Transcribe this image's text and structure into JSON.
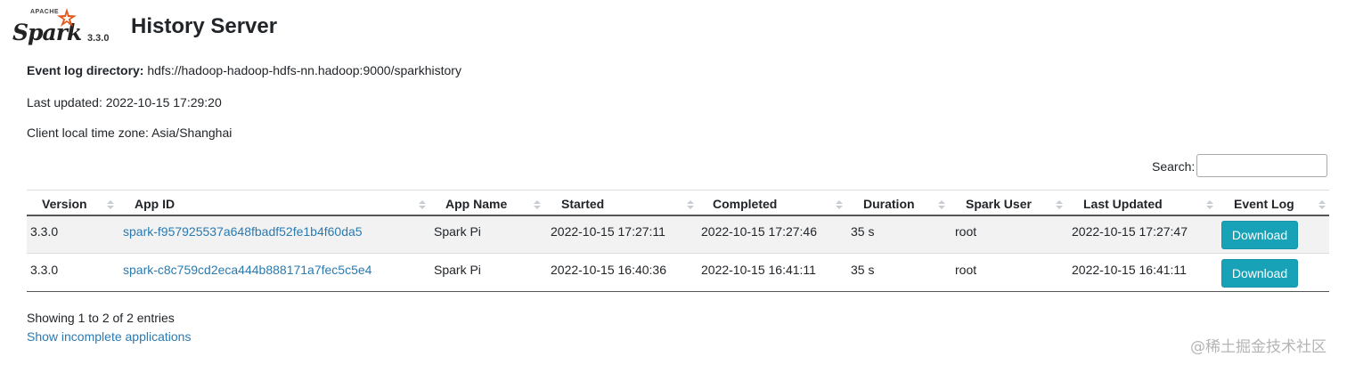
{
  "header": {
    "logo_text": "Spark",
    "logo_small": "APACHE",
    "version": "3.3.0",
    "title": "History Server"
  },
  "info": {
    "event_log_label": "Event log directory:",
    "event_log_value": "hdfs://hadoop-hadoop-hdfs-nn.hadoop:9000/sparkhistory",
    "last_updated": "Last updated: 2022-10-15 17:29:20",
    "timezone": "Client local time zone: Asia/Shanghai"
  },
  "search": {
    "label": "Search:",
    "value": ""
  },
  "table": {
    "columns": [
      "Version",
      "App ID",
      "App Name",
      "Started",
      "Completed",
      "Duration",
      "Spark User",
      "Last Updated",
      "Event Log"
    ],
    "rows": [
      {
        "version": "3.3.0",
        "app_id": "spark-f957925537a648fbadf52fe1b4f60da5",
        "app_name": "Spark Pi",
        "started": "2022-10-15 17:27:11",
        "completed": "2022-10-15 17:27:46",
        "duration": "35 s",
        "user": "root",
        "last_updated": "2022-10-15 17:27:47",
        "event_log": "Download"
      },
      {
        "version": "3.3.0",
        "app_id": "spark-c8c759cd2eca444b888171a7fec5c5e4",
        "app_name": "Spark Pi",
        "started": "2022-10-15 16:40:36",
        "completed": "2022-10-15 16:41:11",
        "duration": "35 s",
        "user": "root",
        "last_updated": "2022-10-15 16:41:11",
        "event_log": "Download"
      }
    ]
  },
  "footer": {
    "entries": "Showing 1 to 2 of 2 entries",
    "incomplete_link": "Show incomplete applications"
  },
  "watermark": "@稀土掘金技术社区",
  "colors": {
    "link": "#2a7ab0",
    "button": "#17a2b8",
    "logo_star": "#e25a1c"
  }
}
